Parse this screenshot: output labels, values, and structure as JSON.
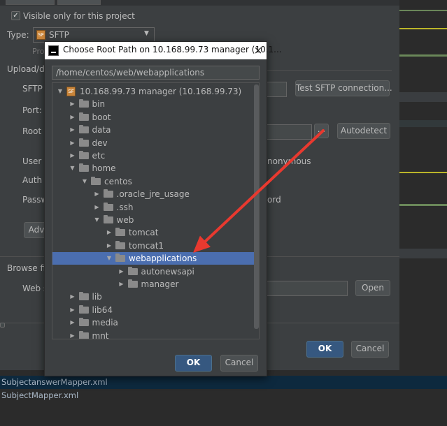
{
  "settings": {
    "visible_only_label": "Visible only for this project",
    "visible_only_checked": "✓",
    "type_label": "Type:",
    "type_value": "SFTP",
    "type_icon_text": "SF",
    "proxy_label": "Pro",
    "upload_section": "Upload/dow",
    "sftp_host_label": "SFTP h",
    "port_label": "Port:",
    "root_path_label": "Root p",
    "user_label": "User n",
    "auth_label": "Auth t",
    "password_label": "Passw",
    "anonymous_label": "nonymous",
    "save_password_label": "ord",
    "advanced_button": "Adv",
    "test_connection_button": "Test SFTP connection...",
    "browse_button": "...",
    "autodetect_button": "Autodetect",
    "browse_files_label": "Browse files",
    "web_server_label": "Web s",
    "open_button": "Open",
    "ok_button": "OK",
    "cancel_button": "Cancel"
  },
  "modal": {
    "title": "Choose Root Path on 10.168.99.73 manager (10.1...",
    "close_icon": "×",
    "path_value": "/home/centos/web/webapplications",
    "ok_button": "OK",
    "cancel_button": "Cancel",
    "tree": [
      {
        "label": "10.168.99.73 manager (10.168.99.73)",
        "depth": 0,
        "expanded": true,
        "icon": "sftp-server-icon",
        "selected": false
      },
      {
        "label": "bin",
        "depth": 1,
        "expanded": false,
        "icon": "folder-icon",
        "selected": false
      },
      {
        "label": "boot",
        "depth": 1,
        "expanded": false,
        "icon": "folder-icon",
        "selected": false
      },
      {
        "label": "data",
        "depth": 1,
        "expanded": false,
        "icon": "folder-icon",
        "selected": false
      },
      {
        "label": "dev",
        "depth": 1,
        "expanded": false,
        "icon": "folder-icon",
        "selected": false
      },
      {
        "label": "etc",
        "depth": 1,
        "expanded": false,
        "icon": "folder-icon",
        "selected": false
      },
      {
        "label": "home",
        "depth": 1,
        "expanded": true,
        "icon": "folder-icon",
        "selected": false
      },
      {
        "label": "centos",
        "depth": 2,
        "expanded": true,
        "icon": "folder-icon",
        "selected": false
      },
      {
        "label": ".oracle_jre_usage",
        "depth": 3,
        "expanded": false,
        "icon": "folder-icon",
        "selected": false
      },
      {
        "label": ".ssh",
        "depth": 3,
        "expanded": false,
        "icon": "folder-icon",
        "selected": false
      },
      {
        "label": "web",
        "depth": 3,
        "expanded": true,
        "icon": "folder-icon",
        "selected": false
      },
      {
        "label": "tomcat",
        "depth": 4,
        "expanded": false,
        "icon": "folder-icon",
        "selected": false
      },
      {
        "label": "tomcat1",
        "depth": 4,
        "expanded": false,
        "icon": "folder-icon",
        "selected": false
      },
      {
        "label": "webapplications",
        "depth": 4,
        "expanded": true,
        "icon": "folder-icon",
        "selected": true
      },
      {
        "label": "autonewsapi",
        "depth": 5,
        "expanded": false,
        "icon": "folder-icon",
        "selected": false
      },
      {
        "label": "manager",
        "depth": 5,
        "expanded": false,
        "icon": "folder-icon",
        "selected": false
      },
      {
        "label": "lib",
        "depth": 1,
        "expanded": false,
        "icon": "folder-icon",
        "selected": false
      },
      {
        "label": "lib64",
        "depth": 1,
        "expanded": false,
        "icon": "folder-icon",
        "selected": false
      },
      {
        "label": "media",
        "depth": 1,
        "expanded": false,
        "icon": "folder-icon",
        "selected": false
      },
      {
        "label": "mnt",
        "depth": 1,
        "expanded": false,
        "icon": "folder-icon",
        "selected": false
      }
    ]
  },
  "bottom_files": [
    "SubjectanswerMapper.xml",
    "SubjectMapper.xml"
  ],
  "colors": {
    "accent_selection": "#4b6eaf",
    "annotation_arrow": "#e8392f",
    "default_button": "#365880"
  }
}
